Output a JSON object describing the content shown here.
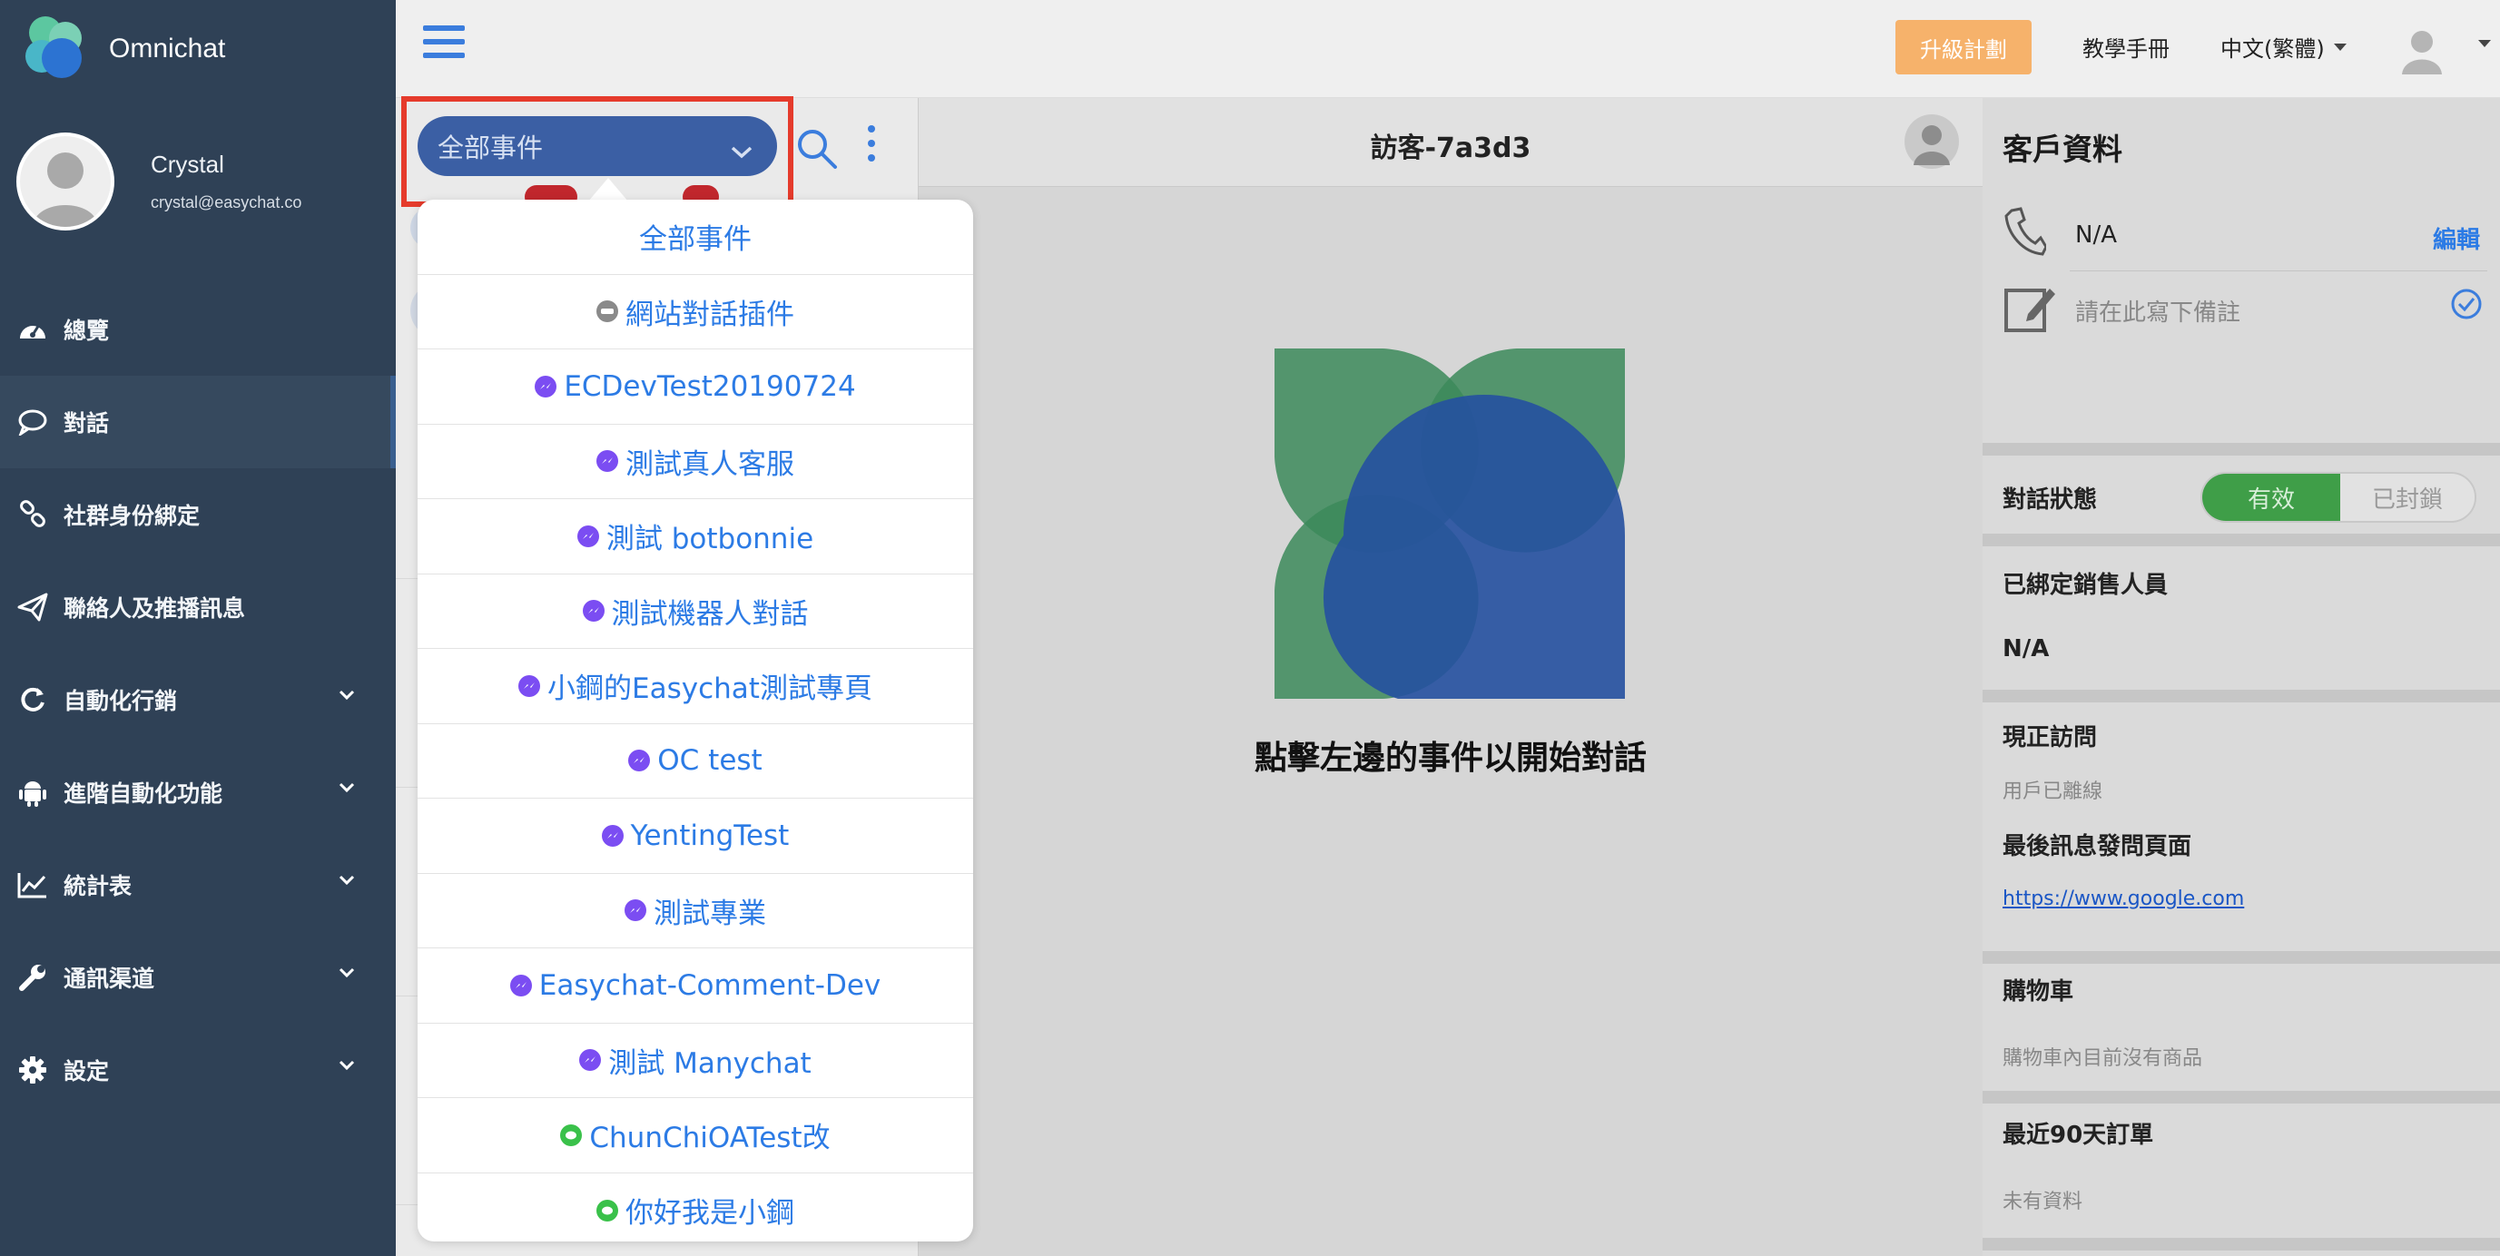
{
  "app": {
    "name": "Omnichat"
  },
  "user": {
    "name": "Crystal",
    "email": "crystal@easychat.co"
  },
  "nav": [
    {
      "label": "總覽",
      "icon": "dashboard-icon",
      "expandable": false,
      "active": false
    },
    {
      "label": "對話",
      "icon": "chat-icon",
      "expandable": false,
      "active": true
    },
    {
      "label": "社群身份綁定",
      "icon": "link-icon",
      "expandable": false,
      "active": false
    },
    {
      "label": "聯絡人及推播訊息",
      "icon": "paper-plane-icon",
      "expandable": false,
      "active": false
    },
    {
      "label": "自動化行銷",
      "icon": "refresh-icon",
      "expandable": true,
      "active": false
    },
    {
      "label": "進階自動化功能",
      "icon": "android-icon",
      "expandable": true,
      "active": false
    },
    {
      "label": "統計表",
      "icon": "line-chart-icon",
      "expandable": true,
      "active": false
    },
    {
      "label": "通訊渠道",
      "icon": "wrench-icon",
      "expandable": true,
      "active": false
    },
    {
      "label": "設定",
      "icon": "gear-icon",
      "expandable": true,
      "active": false
    }
  ],
  "topbar": {
    "upgrade_label": "升級計劃",
    "manual_label": "教學手冊",
    "language": "中文(繁體)"
  },
  "conversation_filter": {
    "selected": "全部事件",
    "options": [
      {
        "label": "全部事件",
        "channel": "none"
      },
      {
        "label": "網站對話插件",
        "channel": "web"
      },
      {
        "label": "ECDevTest20190724",
        "channel": "messenger"
      },
      {
        "label": "測試真人客服",
        "channel": "messenger"
      },
      {
        "label": "測試 botbonnie",
        "channel": "messenger"
      },
      {
        "label": "測試機器人對話",
        "channel": "messenger"
      },
      {
        "label": "小鋼的Easychat測試專頁",
        "channel": "messenger"
      },
      {
        "label": "OC test",
        "channel": "messenger"
      },
      {
        "label": "YentingTest",
        "channel": "messenger"
      },
      {
        "label": "測試專業",
        "channel": "messenger"
      },
      {
        "label": "Easychat-Comment-Dev",
        "channel": "messenger"
      },
      {
        "label": "測試 Manychat",
        "channel": "messenger"
      },
      {
        "label": "ChunChiOATest改",
        "channel": "line"
      },
      {
        "label": "你好我是小鋼",
        "channel": "line"
      }
    ]
  },
  "conversation": {
    "title": "訪客-7a3d3",
    "empty_hint": "點擊左邊的事件以開始對話"
  },
  "customer_panel": {
    "title": "客戶資料",
    "phone": "N/A",
    "edit_label": "編輯",
    "note_placeholder": "請在此寫下備註",
    "status_label": "對話狀態",
    "status_on": "有效",
    "status_off": "已封鎖",
    "sales_label": "已綁定銷售人員",
    "sales_value": "N/A",
    "visit_label": "現正訪問",
    "visit_value": "用戶已離線",
    "last_page_label": "最後訊息發問頁面",
    "last_page_url": "https://www.google.com",
    "cart_label": "購物車",
    "cart_value": "購物車內目前沒有商品",
    "orders_label": "最近90天訂單",
    "orders_value": "未有資料"
  },
  "colors": {
    "sidebar": "#2f4156",
    "accent": "#3b7ddd",
    "upgrade": "#f6b26b",
    "filter": "#3b5fa4",
    "highlight": "#e53b2c",
    "status_on": "#3f9e48",
    "messenger": "#7b4df2",
    "line": "#3ac14a"
  }
}
